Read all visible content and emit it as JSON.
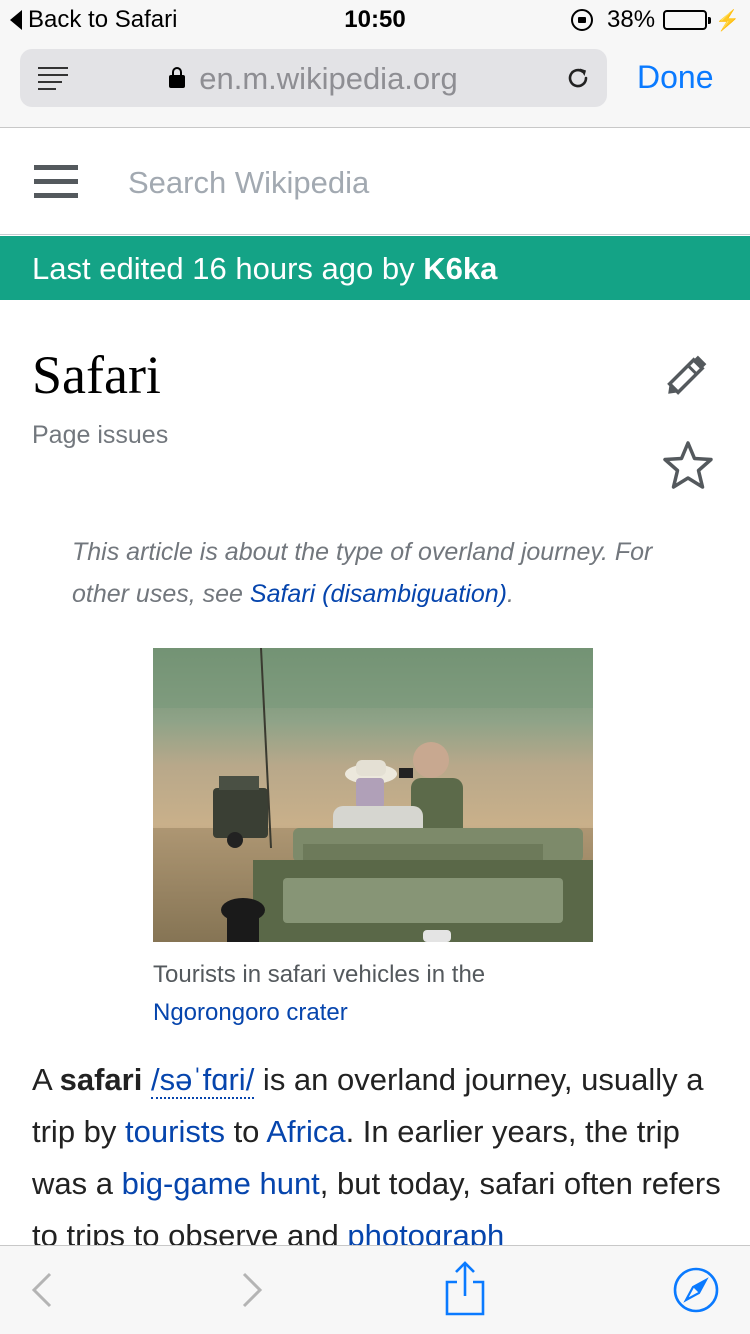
{
  "status_bar": {
    "back_label": "Back to Safari",
    "time": "10:50",
    "battery_percent": "38%",
    "battery_level": 0.38
  },
  "browser": {
    "url": "en.m.wikipedia.org",
    "done_label": "Done"
  },
  "wiki_header": {
    "search_placeholder": "Search Wikipedia"
  },
  "edited_banner": {
    "prefix": "Last edited 16 hours ago by ",
    "user": "K6ka"
  },
  "article": {
    "title": "Safari",
    "page_issues": "Page issues",
    "hatnote_text": "This article is about the type of overland journey. For other uses, see ",
    "hatnote_link": "Safari (disambiguation)",
    "hatnote_end": ".",
    "caption_text": "Tourists in safari vehicles in the ",
    "caption_link": "Ngorongoro crater",
    "body": {
      "p1": "A ",
      "bold": "safari",
      "p2": " ",
      "ipa": "/səˈfɑri/",
      "p3": " is an overland journey, usually a trip by ",
      "link_tourists": "tourists",
      "p4": " to ",
      "link_africa": "Africa",
      "p5": ". In earlier years, the trip was a ",
      "link_hunt": "big-game hunt",
      "p6": ", but today, safari often refers to trips to observe and ",
      "link_photograph": "photograph"
    }
  },
  "icons": {
    "reader": "reader-view-icon",
    "reload": "reload-icon",
    "menu": "hamburger-menu-icon",
    "edit": "pencil-icon",
    "watch": "star-icon",
    "back": "chevron-left-icon",
    "forward": "chevron-right-icon",
    "share": "share-icon",
    "safari": "compass-icon"
  },
  "colors": {
    "banner": "#14a386",
    "link": "#0645ad",
    "ios_blue": "#0a7aff"
  }
}
